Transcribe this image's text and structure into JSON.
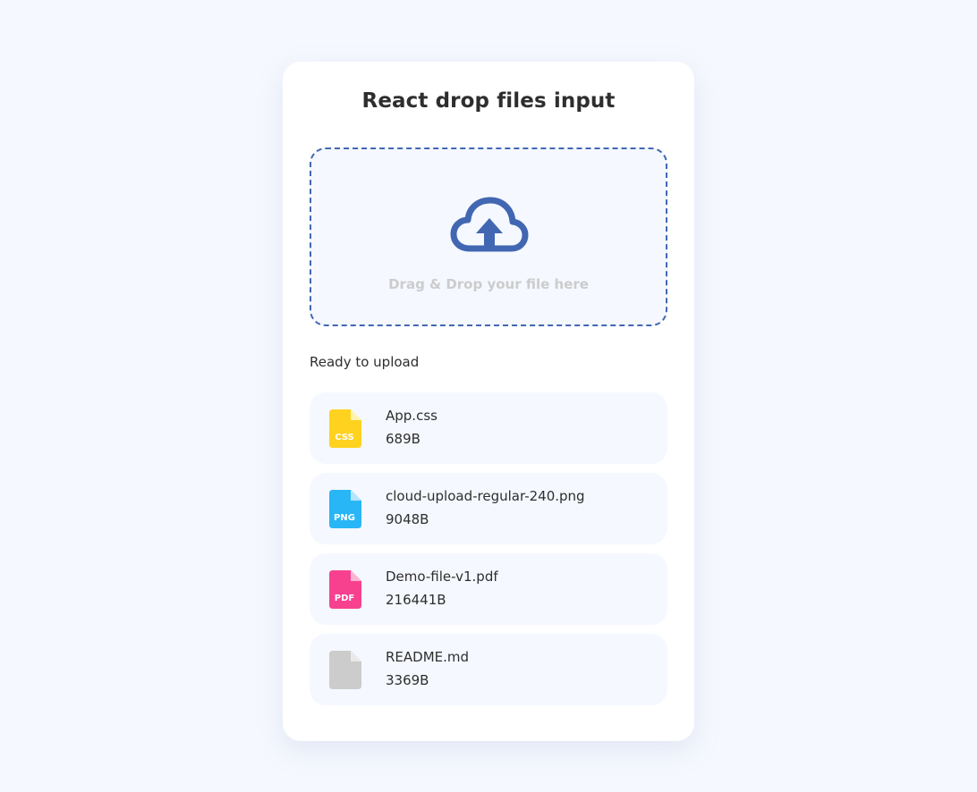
{
  "title": "React drop files input",
  "dropzone": {
    "hint": "Drag & Drop your file here",
    "icon": "cloud-upload-icon",
    "accent_color": "#4267b2"
  },
  "section_label": "Ready to upload",
  "files": [
    {
      "name": "App.css",
      "size": "689B",
      "badge": "CSS",
      "icon": "css-file-icon",
      "color": "#ffd21f"
    },
    {
      "name": "cloud-upload-regular-240.png",
      "size": "9048B",
      "badge": "PNG",
      "icon": "png-file-icon",
      "color": "#29b6f6"
    },
    {
      "name": "Demo-file-v1.pdf",
      "size": "216441B",
      "badge": "PDF",
      "icon": "pdf-file-icon",
      "color": "#f7418f"
    },
    {
      "name": "README.md",
      "size": "3369B",
      "badge": "",
      "icon": "default-file-icon",
      "color": "#cccccc"
    }
  ]
}
